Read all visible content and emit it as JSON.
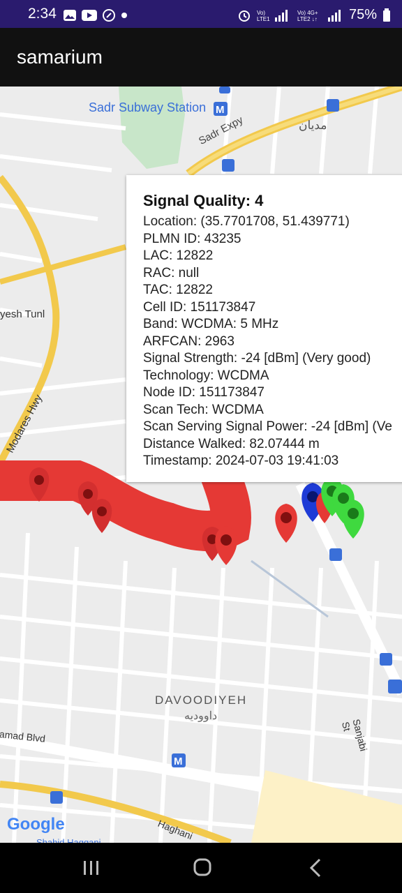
{
  "status_bar": {
    "time": "2:34",
    "net1": "VoLTE1",
    "net2": "VoLTE2 4G+",
    "battery": "75%"
  },
  "app": {
    "title": "samarium"
  },
  "map": {
    "labels": {
      "subway": "Sadr Subway Station",
      "expy": "Sadr Expy",
      "modares": "Modares Hwy",
      "tunnel": "yesh Tunl",
      "farsi_top": "مدیان",
      "district": "DAVOODIYEH",
      "district_fa": "داوودیه",
      "ahmad": "amad Blvd",
      "sanjabi": "Sanjabi St",
      "haghani": "Haghani",
      "shahid": "Shahid Haqqani",
      "google": "Google"
    }
  },
  "popup": {
    "title": "Signal Quality: 4",
    "lines": [
      "Location: (35.7701708, 51.439771)",
      "PLMN ID: 43235",
      "LAC: 12822",
      "RAC: null",
      "TAC: 12822",
      "Cell ID: 151173847",
      "Band: WCDMA: 5 MHz",
      "ARFCAN: 2963",
      "Signal Strength: -24 [dBm] (Very good)",
      "Technology: WCDMA",
      "Node ID: 151173847",
      "Scan Tech: WCDMA",
      "Scan Serving Signal Power: -24 [dBm] (Ve",
      "Distance Walked: 82.07444 m",
      "Timestamp: 2024-07-03 19:41:03"
    ]
  },
  "markers": {
    "red": "#e53935",
    "blue": "#1e3bd6",
    "green": "#3fd93f"
  }
}
